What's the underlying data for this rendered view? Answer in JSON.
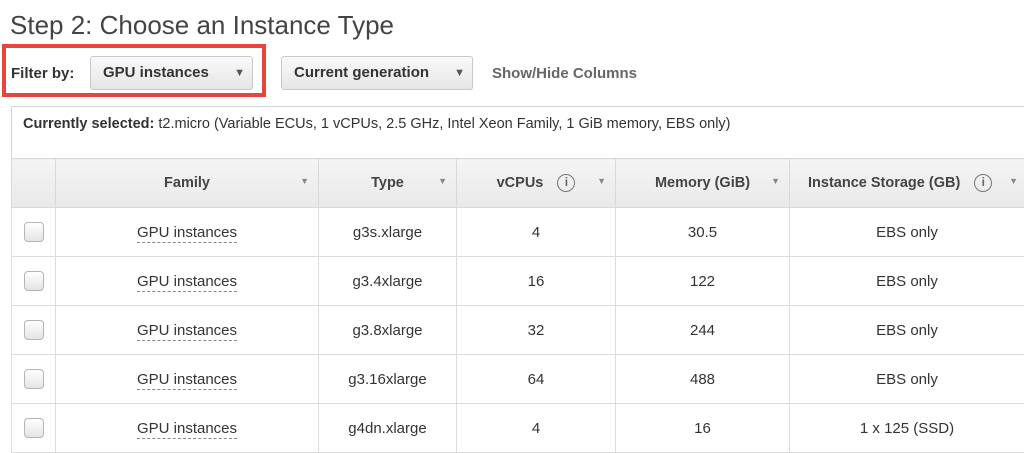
{
  "page": {
    "title": "Step 2: Choose an Instance Type"
  },
  "filter": {
    "label": "Filter by:",
    "family_select": "GPU instances",
    "generation_select": "Current generation",
    "show_hide_columns": "Show/Hide Columns"
  },
  "selection": {
    "label": "Currently selected:",
    "value": "t2.micro (Variable ECUs, 1 vCPUs, 2.5 GHz, Intel Xeon Family, 1 GiB memory, EBS only)"
  },
  "table": {
    "columns": [
      "Family",
      "Type",
      "vCPUs",
      "Memory (GiB)",
      "Instance Storage (GB)"
    ],
    "rows": [
      {
        "family": "GPU instances",
        "type": "g3s.xlarge",
        "vcpus": "4",
        "memory": "30.5",
        "storage": "EBS only"
      },
      {
        "family": "GPU instances",
        "type": "g3.4xlarge",
        "vcpus": "16",
        "memory": "122",
        "storage": "EBS only"
      },
      {
        "family": "GPU instances",
        "type": "g3.8xlarge",
        "vcpus": "32",
        "memory": "244",
        "storage": "EBS only"
      },
      {
        "family": "GPU instances",
        "type": "g3.16xlarge",
        "vcpus": "64",
        "memory": "488",
        "storage": "EBS only"
      },
      {
        "family": "GPU instances",
        "type": "g4dn.xlarge",
        "vcpus": "4",
        "memory": "16",
        "storage": "1 x 125 (SSD)"
      }
    ]
  },
  "icons": {
    "info": "info-icon",
    "dropdown": "chevron-down-icon",
    "sort": "sort-caret-icon"
  },
  "colors": {
    "highlight": "#e8463a"
  }
}
